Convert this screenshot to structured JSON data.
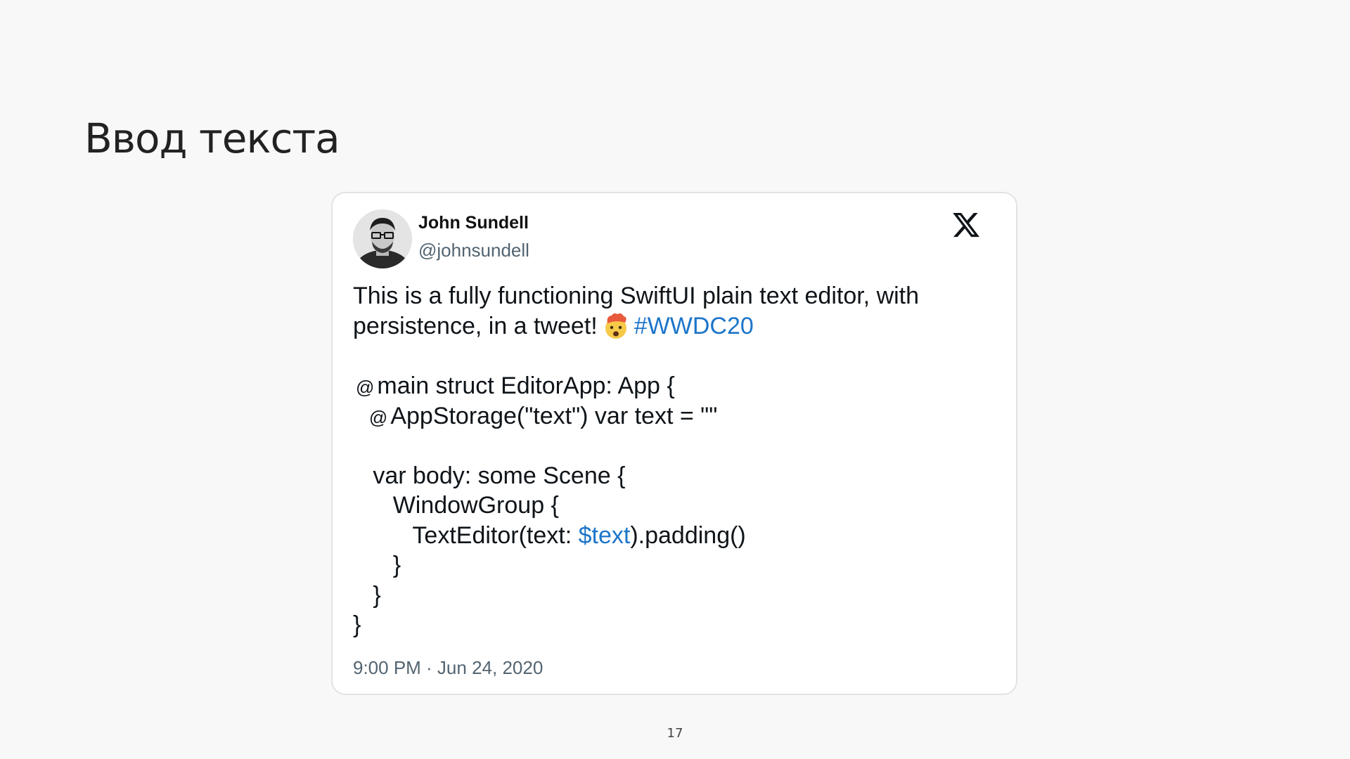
{
  "slide": {
    "title": "Ввод текста",
    "page_number": "17"
  },
  "tweet": {
    "author_name": "John Sundell",
    "author_handle": "@johnsundell",
    "text_line1": "This is a fully functioning SwiftUI plain text editor, with",
    "text_line2": "persistence, in a tweet!",
    "emoji": "exploding-head",
    "hashtag": "#WWDC20",
    "code": {
      "at": "@",
      "l1": "main struct EditorApp: App {",
      "l2": "AppStorage(\"text\") var text = \"\"",
      "l4": "var body: some Scene {",
      "l5": "WindowGroup {",
      "l6_prefix": "TextEditor(text: ",
      "l6_var": "$text",
      "l6_suffix": ").padding()",
      "l7": "}",
      "l8": "}",
      "l9": "}"
    },
    "timestamp": "9:00 PM · Jun 24, 2020",
    "platform_icon": "x-logo-icon"
  },
  "colors": {
    "background": "#f8f8f8",
    "card": "#ffffff",
    "link": "#1d75c9",
    "muted": "#536471"
  }
}
